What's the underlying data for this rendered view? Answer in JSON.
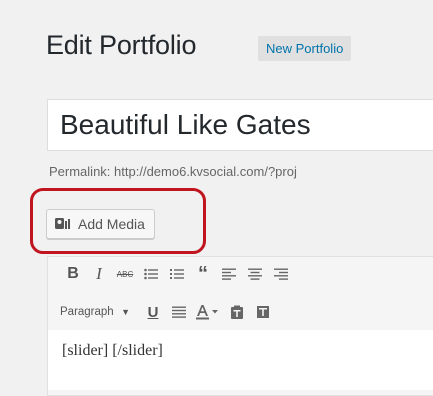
{
  "header": {
    "title": "Edit Portfolio",
    "add_new_label": "New Portfolio"
  },
  "post": {
    "title_value": "Beautiful Like Gates",
    "permalink_label": "Permalink:",
    "permalink_url": "http://demo6.kvsocial.com/?proj",
    "content": "[slider] [/slider]"
  },
  "media": {
    "add_media_label": "Add Media"
  },
  "toolbar": {
    "row1": [
      "bold-icon",
      "italic-icon",
      "strikethrough-icon",
      "bullet-list-icon",
      "numbered-list-icon",
      "blockquote-icon",
      "align-left-icon",
      "align-center-icon",
      "align-right-icon"
    ],
    "format_select_value": "Paragraph",
    "row2": [
      "underline-icon",
      "justify-icon",
      "text-color-icon",
      "paste-as-text-icon",
      "clear-formatting-icon"
    ]
  },
  "colors": {
    "highlight": "#c0141e",
    "link": "#0073aa"
  }
}
